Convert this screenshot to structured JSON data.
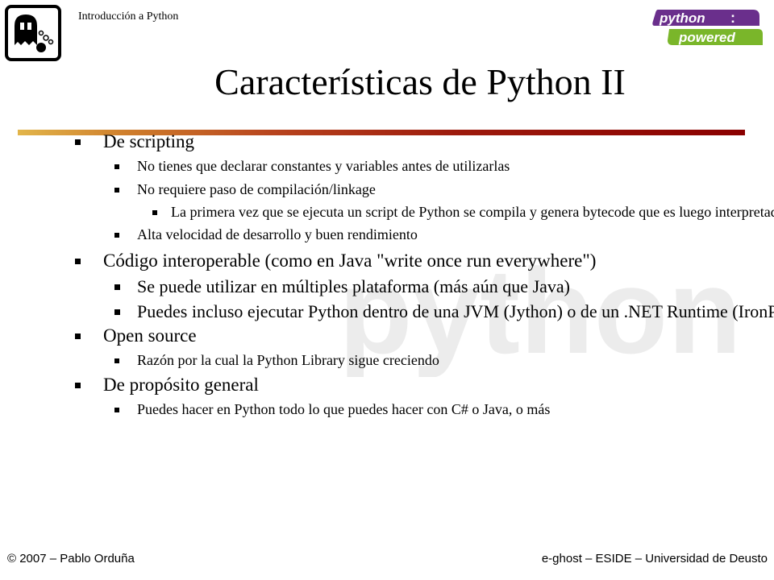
{
  "header": {
    "label": "Introducción a Python"
  },
  "logos": {
    "ghost_icon": "ghost-icon",
    "python_powered_text_top": "python",
    "python_powered_colon": ":",
    "python_powered_text_bottom": "powered",
    "python_powered_colors": {
      "top_band": "#6a2f8c",
      "bottom_band": "#7ab62a"
    }
  },
  "watermark": {
    "text": "python",
    "color": "#000000"
  },
  "title": "Características de Python II",
  "rule_colors": [
    "#e2b54a",
    "#cf7e2c",
    "#b8441e",
    "#9d1b0d",
    "#8a0000"
  ],
  "bullets": [
    {
      "level": 1,
      "text": "De scripting"
    },
    {
      "level": 2,
      "text": "No tienes que declarar constantes y variables antes de utilizarlas"
    },
    {
      "level": 2,
      "text": "No requiere paso de compilación/linkage"
    },
    {
      "level": 3,
      "text": "La primera vez que se ejecuta un script de Python se compila y genera bytecode que es luego interpretado"
    },
    {
      "level": 2,
      "text": "Alta velocidad de desarrollo y buen rendimiento"
    },
    {
      "level": 1,
      "text": "Código interoperable (como en Java \"write once run everywhere\")"
    },
    {
      "level": 2,
      "text": "Se puede utilizar en múltiples plataforma (más aún que Java)"
    },
    {
      "level": 2,
      "text": "Puedes incluso ejecutar Python dentro de una JVM (Jython) o de un .NET Runtime (IronPython)"
    },
    {
      "level": 1,
      "text": "Open source"
    },
    {
      "level": 2,
      "text": "Razón por la cual la Python Library sigue creciendo"
    },
    {
      "level": 1,
      "text": "De propósito general"
    },
    {
      "level": 2,
      "text": "Puedes hacer en Python todo lo que puedes hacer con C# o Java, o más"
    }
  ],
  "footer": {
    "left": "© 2007 – Pablo Orduña",
    "right": "e-ghost – ESIDE – Universidad de Deusto"
  }
}
